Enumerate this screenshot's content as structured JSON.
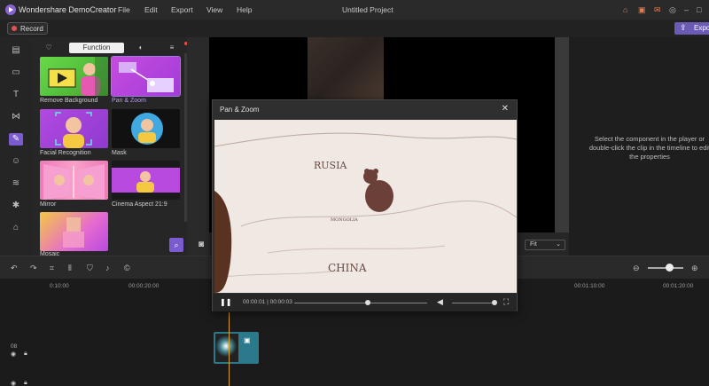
{
  "app": {
    "name": "Wondershare DemoCreator",
    "document_title": "Untitled Project",
    "menu": [
      "File",
      "Edit",
      "Export",
      "View",
      "Help"
    ]
  },
  "toolbar": {
    "record_label": "Record",
    "export_label": "Export"
  },
  "panel": {
    "tabs": [
      "Function"
    ],
    "cards": [
      {
        "label": "Remove Background"
      },
      {
        "label": "Pan & Zoom"
      },
      {
        "label": "Facial Recognition"
      },
      {
        "label": "Mask"
      },
      {
        "label": "Mirror"
      },
      {
        "label": "Cinema Aspect 21:9"
      },
      {
        "label": "Mosaic"
      }
    ]
  },
  "preview": {
    "fit_label": "Fit"
  },
  "properties": {
    "hint": "Select the component in the player or double-click the clip in the timeline to edit the properties"
  },
  "dialog": {
    "title": "Pan & Zoom",
    "time": "00:00:01 | 00:00:03",
    "map_labels": [
      "RUSIA",
      "MONGOLIA",
      "CHINA"
    ]
  },
  "timeline": {
    "ticks": [
      "0:10:00",
      "00:00:20:00",
      "00:01:10:00",
      "00:01:20:00"
    ],
    "track_number": "08"
  },
  "colors": {
    "accent": "#7a5bd0",
    "export": "#6c5bb5",
    "clip": "#2a7a8c",
    "playhead": "#e0a020"
  }
}
